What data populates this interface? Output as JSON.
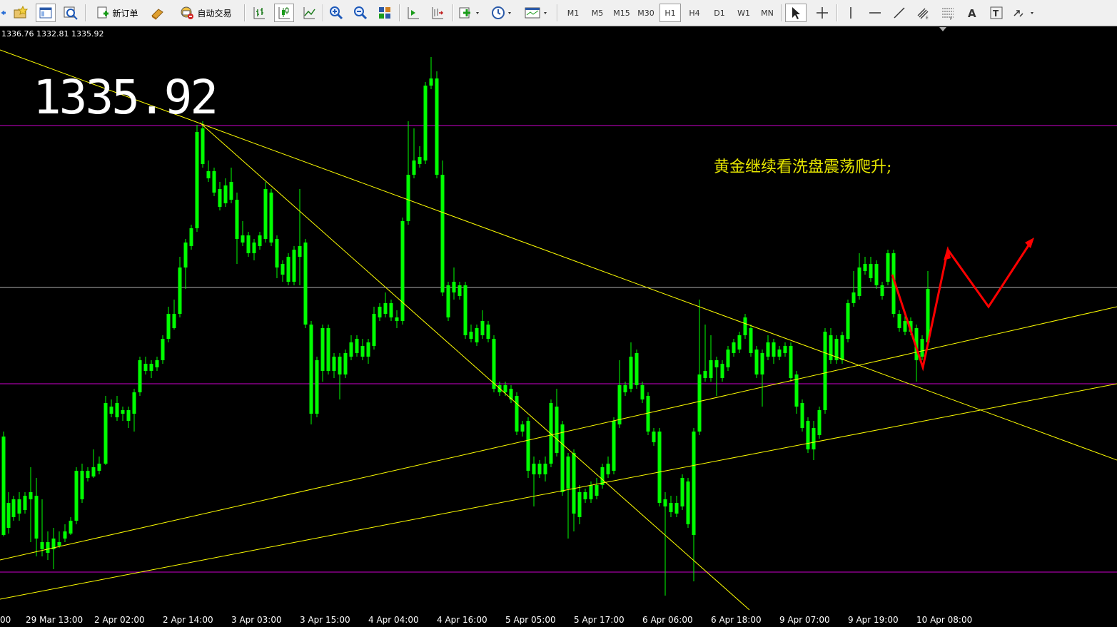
{
  "toolbar": {
    "new_order_label": "新订单",
    "auto_trading_label": "自动交易",
    "timeframes": [
      "M1",
      "M5",
      "M15",
      "M30",
      "H1",
      "H4",
      "D1",
      "W1",
      "MN"
    ],
    "active_timeframe": "H1",
    "icons": [
      "back-arrow-icon",
      "favorites-icon",
      "profiles-icon",
      "zoom-chart-icon",
      "new-order-icon",
      "metaeditor-icon",
      "auto-trading-icon",
      "bar-chart-icon",
      "candlestick-icon",
      "line-chart-icon",
      "zoom-in-icon",
      "zoom-out-icon",
      "tile-windows-icon",
      "autoscroll-icon",
      "chart-shift-icon",
      "indicators-icon",
      "periods-icon",
      "templates-icon",
      "cursor-icon",
      "crosshair-icon",
      "vertical-line-icon",
      "horizontal-line-icon",
      "trendline-icon",
      "equidistant-channel-icon",
      "fibonacci-icon",
      "text-icon",
      "text-label-icon",
      "arrows-icon"
    ]
  },
  "chart": {
    "ohlc_text": "1336.76 1332.81 1335.92",
    "big_price": "1335.92",
    "annotation": "黄金继续看洗盘震荡爬升;",
    "colors": {
      "bull": "#ff0000",
      "bear": "#00ff00",
      "trendline": "#ffff00",
      "level_line": "#cc00cc",
      "mid_line": "#b0b0b0",
      "forecast": "#ff0000"
    },
    "x_labels": [
      "29 Mar 13:00",
      "2 Apr 02:00",
      "2 Apr 14:00",
      "3 Apr 03:00",
      "3 Apr 15:00",
      "4 Apr 04:00",
      "4 Apr 16:00",
      "5 Apr 05:00",
      "5 Apr 17:00",
      "6 Apr 06:00",
      "6 Apr 18:00",
      "9 Apr 07:00",
      "9 Apr 19:00",
      "10 Apr 08:00"
    ],
    "x_label_partial": "00"
  }
}
